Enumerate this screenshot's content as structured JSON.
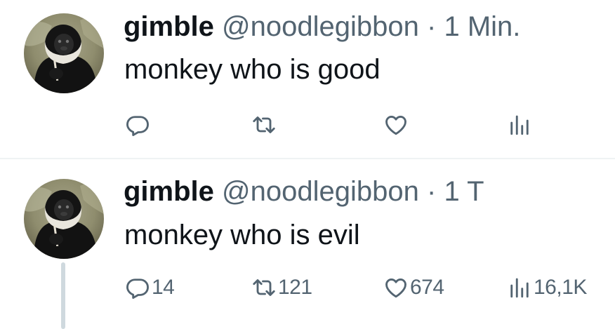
{
  "tweets": [
    {
      "author": {
        "display_name": "gimble",
        "handle": "@noodlegibbon",
        "avatar_icon": "gibbon-avatar"
      },
      "separator": "·",
      "timestamp": "1 Min.",
      "text": "monkey who is good",
      "counts": {
        "replies": "",
        "retweets": "",
        "likes": "",
        "views": ""
      }
    },
    {
      "author": {
        "display_name": "gimble",
        "handle": "@noodlegibbon",
        "avatar_icon": "gibbon-avatar"
      },
      "separator": "·",
      "timestamp": "1 T",
      "text": "monkey who is evil",
      "counts": {
        "replies": "14",
        "retweets": "121",
        "likes": "674",
        "views": "16,1K"
      }
    }
  ],
  "icons": {
    "reply": "speech-bubble-icon",
    "retweet": "retweet-arrows-icon",
    "like": "heart-icon",
    "views": "bar-chart-icon"
  },
  "colors": {
    "text_primary": "#0f1419",
    "text_secondary": "#536471",
    "divider": "#eff3f4",
    "thread_line": "#cfd9de"
  }
}
